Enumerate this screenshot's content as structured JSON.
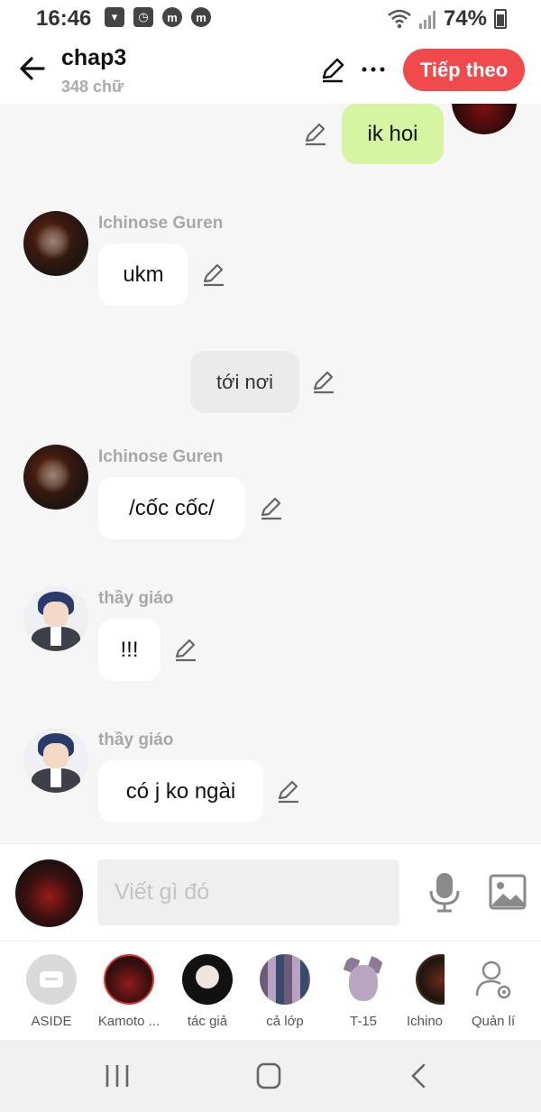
{
  "status_bar": {
    "time": "16:46",
    "battery": "74%",
    "notification_icons": [
      "shopping-bag-icon",
      "clock-app-icon",
      "m-app-icon",
      "m-app-icon"
    ]
  },
  "header": {
    "title": "chap3",
    "subtitle": "348 chữ",
    "next_label": "Tiếp theo",
    "accent_color": "#f04a4d"
  },
  "messages": [
    {
      "kind": "self",
      "text": "ik hoi"
    },
    {
      "kind": "other",
      "sender": "Ichinose Guren",
      "text": "ukm"
    },
    {
      "kind": "narration",
      "text": "tới nơi"
    },
    {
      "kind": "other",
      "sender": "Ichinose Guren",
      "text": "/cốc cốc/"
    },
    {
      "kind": "other",
      "sender": "thầy giáo",
      "text": "!!!"
    },
    {
      "kind": "other",
      "sender": "thầy giáo",
      "text": "có j ko ngài"
    }
  ],
  "composer": {
    "placeholder": "Viết gì đó"
  },
  "characters": [
    {
      "label": "ASIDE"
    },
    {
      "label": "Kamoto ..."
    },
    {
      "label": "tác giả"
    },
    {
      "label": "cả lớp"
    },
    {
      "label": "T-15"
    },
    {
      "label": "Ichino"
    },
    {
      "label": "Quản lí"
    }
  ],
  "colors": {
    "self_bubble": "#d6f5a3",
    "other_bubble": "#ffffff",
    "narration_bubble": "#ebebeb",
    "background": "#f6f6f6"
  }
}
